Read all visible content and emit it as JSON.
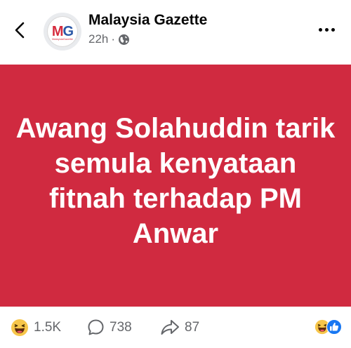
{
  "header": {
    "page_name": "Malaysia Gazette",
    "time": "22h",
    "separator": "·",
    "logo_letters_m": "M",
    "logo_letters_g": "G",
    "logo_subtext": "MalaysiaGazette"
  },
  "post": {
    "headline": "Awang Solahuddin tarik semula kenyataan fitnah terhadap PM Anwar",
    "background_color": "#d02a40"
  },
  "footer": {
    "reactions_count": "1.5K",
    "comments_count": "738",
    "shares_count": "87"
  },
  "icons": [
    "back-icon",
    "globe-icon",
    "more-icon",
    "haha-icon",
    "comment-icon",
    "share-icon",
    "like-icon"
  ]
}
